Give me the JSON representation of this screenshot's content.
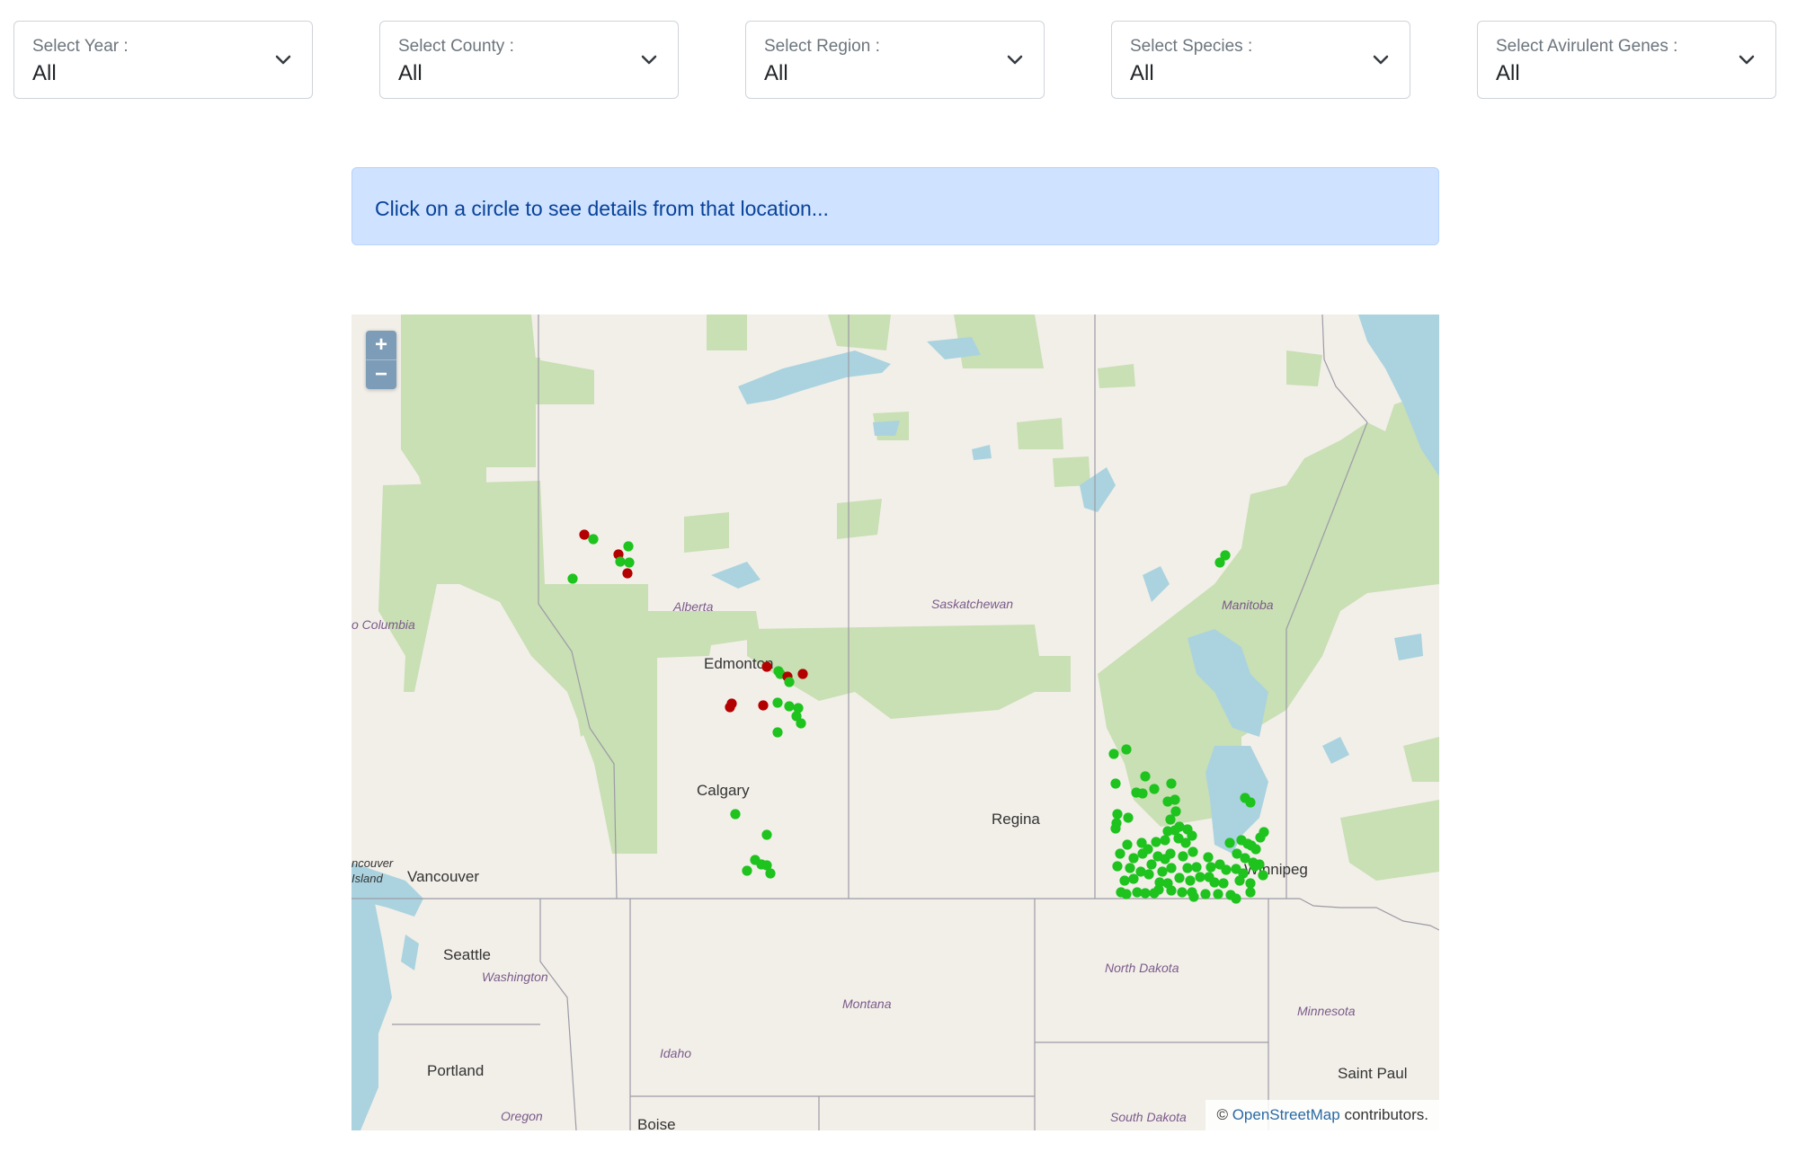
{
  "filters": [
    {
      "label": "Select Year :",
      "value": "All"
    },
    {
      "label": "Select County :",
      "value": "All"
    },
    {
      "label": "Select Region :",
      "value": "All"
    },
    {
      "label": "Select Species :",
      "value": "All"
    },
    {
      "label": "Select Avirulent Genes :",
      "value": "All"
    }
  ],
  "info_message": "Click on a circle to see details from that location...",
  "map": {
    "zoom_in": "+",
    "zoom_out": "−",
    "attribution_prefix": "©",
    "attribution_link": "OpenStreetMap",
    "attribution_suffix": "contributors.",
    "labels": {
      "alberta": "Alberta",
      "saskatchewan": "Saskatchewan",
      "manitoba": "Manitoba",
      "columbia": "o Columbia",
      "edmonton": "Edmonton",
      "calgary": "Calgary",
      "regina": "Regina",
      "winnipeg": "Winnipeg",
      "vancouver_island_1": "ncouver",
      "vancouver_island_2": "Island",
      "vancouver": "Vancouver",
      "seattle": "Seattle",
      "washington": "Washington",
      "montana": "Montana",
      "north_dakota": "North Dakota",
      "minnesota": "Minnesota",
      "idaho": "Idaho",
      "portland": "Portland",
      "oregon": "Oregon",
      "boise": "Boise",
      "south_dakota": "South Dakota",
      "saint_paul": "Saint Paul"
    },
    "colors": {
      "green_point": "#1ec31e",
      "red_point": "#b30000",
      "water": "#aad3df",
      "forest": "#c9dfb4",
      "land": "#f2efe9"
    }
  }
}
